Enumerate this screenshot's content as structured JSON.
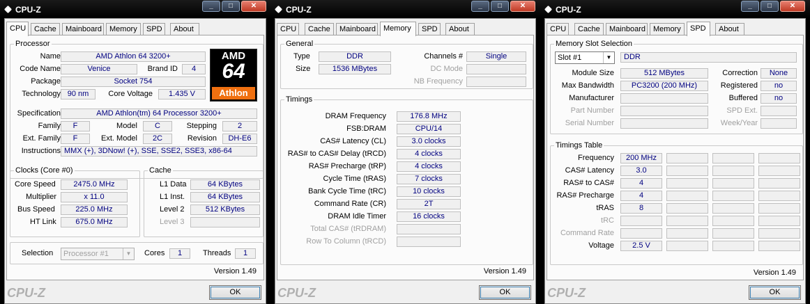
{
  "windows": [
    {
      "title": "CPU-Z",
      "tabs": [
        "CPU",
        "Cache",
        "Mainboard",
        "Memory",
        "SPD",
        "About"
      ],
      "active_tab": "CPU",
      "processor": {
        "group_title": "Processor",
        "name_label": "Name",
        "name": "AMD Athlon 64 3200+",
        "code_name_label": "Code Name",
        "code_name": "Venice",
        "brand_id_label": "Brand ID",
        "brand_id": "4",
        "package_label": "Package",
        "package": "Socket 754",
        "technology_label": "Technology",
        "technology": "90 nm",
        "core_voltage_label": "Core Voltage",
        "core_voltage": "1.435 V",
        "specification_label": "Specification",
        "specification": "AMD Athlon(tm) 64 Processor 3200+",
        "family_label": "Family",
        "family": "F",
        "model_label": "Model",
        "model": "C",
        "stepping_label": "Stepping",
        "stepping": "2",
        "ext_family_label": "Ext. Family",
        "ext_family": "F",
        "ext_model_label": "Ext. Model",
        "ext_model": "2C",
        "revision_label": "Revision",
        "revision": "DH-E6",
        "instructions_label": "Instructions",
        "instructions": "MMX (+), 3DNow! (+), SSE, SSE2, SSE3, x86-64",
        "logo": {
          "brand": "AMD",
          "number": "64",
          "line": "Athlon"
        }
      },
      "clocks": {
        "group_title": "Clocks (Core #0)",
        "core_speed_label": "Core Speed",
        "core_speed": "2475.0 MHz",
        "multiplier_label": "Multiplier",
        "multiplier": "x 11.0",
        "bus_speed_label": "Bus Speed",
        "bus_speed": "225.0 MHz",
        "ht_link_label": "HT Link",
        "ht_link": "675.0 MHz"
      },
      "cache": {
        "group_title": "Cache",
        "l1_data_label": "L1 Data",
        "l1_data": "64 KBytes",
        "l1_inst_label": "L1 Inst.",
        "l1_inst": "64 KBytes",
        "level2_label": "Level 2",
        "level2": "512 KBytes",
        "level3_label": "Level 3",
        "level3": ""
      },
      "selection": {
        "label": "Selection",
        "value": "Processor #1",
        "cores_label": "Cores",
        "cores": "1",
        "threads_label": "Threads",
        "threads": "1"
      },
      "version": "Version 1.49",
      "brand": "CPU-Z",
      "ok": "OK"
    },
    {
      "title": "CPU-Z",
      "tabs": [
        "CPU",
        "Cache",
        "Mainboard",
        "Memory",
        "SPD",
        "About"
      ],
      "active_tab": "Memory",
      "general": {
        "group_title": "General",
        "type_label": "Type",
        "type": "DDR",
        "size_label": "Size",
        "size": "1536 MBytes",
        "channels_label": "Channels #",
        "channels": "Single",
        "dc_mode_label": "DC Mode",
        "dc_mode": "",
        "nb_freq_label": "NB Frequency",
        "nb_freq": ""
      },
      "timings": {
        "group_title": "Timings",
        "rows": [
          {
            "label": "DRAM Frequency",
            "value": "176.8 MHz",
            "enabled": true
          },
          {
            "label": "FSB:DRAM",
            "value": "CPU/14",
            "enabled": true
          },
          {
            "label": "CAS# Latency (CL)",
            "value": "3.0 clocks",
            "enabled": true
          },
          {
            "label": "RAS# to CAS# Delay (tRCD)",
            "value": "4 clocks",
            "enabled": true
          },
          {
            "label": "RAS# Precharge (tRP)",
            "value": "4 clocks",
            "enabled": true
          },
          {
            "label": "Cycle Time (tRAS)",
            "value": "7 clocks",
            "enabled": true
          },
          {
            "label": "Bank Cycle Time (tRC)",
            "value": "10 clocks",
            "enabled": true
          },
          {
            "label": "Command Rate (CR)",
            "value": "2T",
            "enabled": true
          },
          {
            "label": "DRAM Idle Timer",
            "value": "16 clocks",
            "enabled": true
          },
          {
            "label": "Total CAS# (tRDRAM)",
            "value": "",
            "enabled": false
          },
          {
            "label": "Row To Column (tRCD)",
            "value": "",
            "enabled": false
          }
        ]
      },
      "version": "Version 1.49",
      "brand": "CPU-Z",
      "ok": "OK"
    },
    {
      "title": "CPU-Z",
      "tabs": [
        "CPU",
        "Cache",
        "Mainboard",
        "Memory",
        "SPD",
        "About"
      ],
      "active_tab": "SPD",
      "slot": {
        "group_title": "Memory Slot Selection",
        "slot_value": "Slot #1",
        "type": "DDR",
        "module_size_label": "Module Size",
        "module_size": "512 MBytes",
        "max_bandwidth_label": "Max Bandwidth",
        "max_bandwidth": "PC3200 (200 MHz)",
        "manufacturer_label": "Manufacturer",
        "manufacturer": "",
        "part_number_label": "Part Number",
        "part_number": "",
        "serial_number_label": "Serial Number",
        "serial_number": "",
        "correction_label": "Correction",
        "correction": "None",
        "registered_label": "Registered",
        "registered": "no",
        "buffered_label": "Buffered",
        "buffered": "no",
        "spd_ext_label": "SPD Ext.",
        "spd_ext": "",
        "week_year_label": "Week/Year",
        "week_year": ""
      },
      "timings_table": {
        "group_title": "Timings Table",
        "rows": [
          {
            "label": "Frequency",
            "value": "200 MHz",
            "enabled": true
          },
          {
            "label": "CAS# Latency",
            "value": "3.0",
            "enabled": true
          },
          {
            "label": "RAS# to CAS#",
            "value": "4",
            "enabled": true
          },
          {
            "label": "RAS# Precharge",
            "value": "4",
            "enabled": true
          },
          {
            "label": "tRAS",
            "value": "8",
            "enabled": true
          },
          {
            "label": "tRC",
            "value": "",
            "enabled": false
          },
          {
            "label": "Command Rate",
            "value": "",
            "enabled": false
          },
          {
            "label": "Voltage",
            "value": "2.5 V",
            "enabled": true
          }
        ]
      },
      "version": "Version 1.49",
      "brand": "CPU-Z",
      "ok": "OK"
    }
  ]
}
